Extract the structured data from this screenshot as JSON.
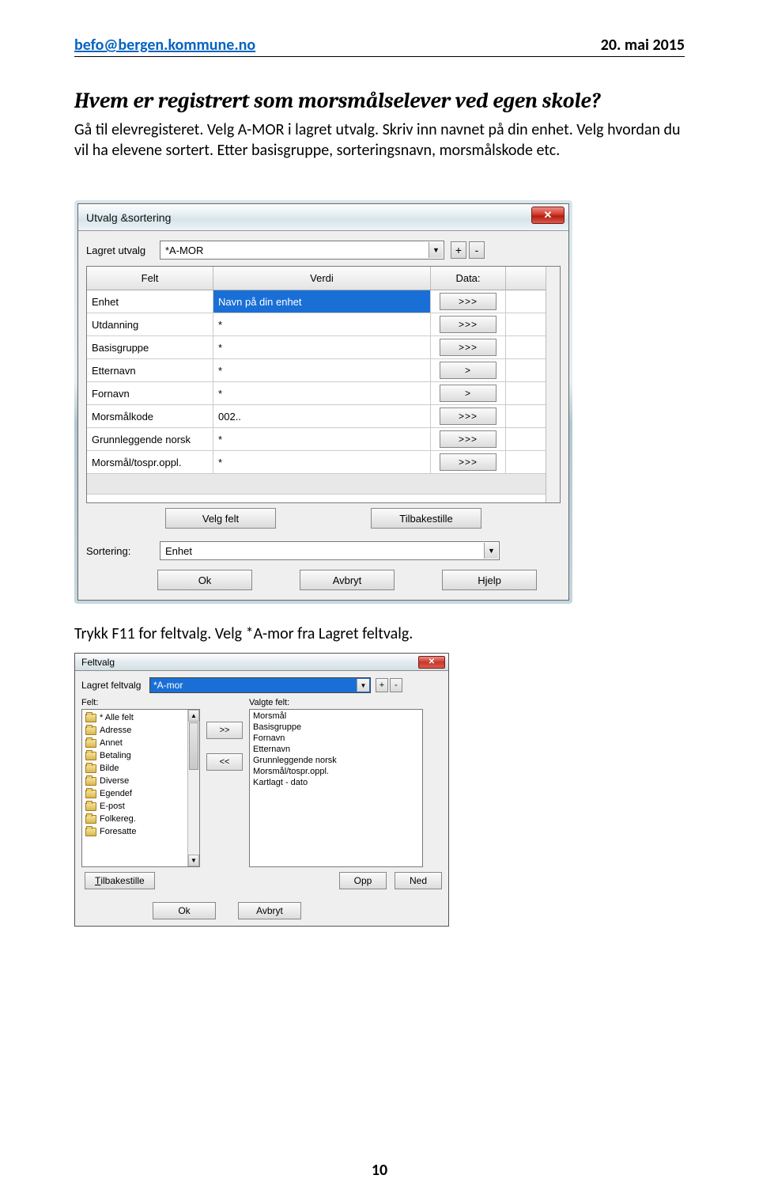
{
  "header": {
    "email": "befo@bergen.kommune.no",
    "date": "20. mai 2015"
  },
  "heading": "Hvem er registrert som morsmålselever ved egen skole?",
  "paragraph": "Gå til elevregisteret. Velg A-MOR i lagret utvalg. Skriv inn navnet på din enhet. Velg hvordan du vil ha elevene sortert. Etter basisgruppe, sorteringsnavn, morsmålskode etc.",
  "dialog1": {
    "title": "Utvalg &sortering",
    "lagret_label": "Lagret utvalg",
    "lagret_value": "*A-MOR",
    "plus": "+",
    "minus": "-",
    "headers": {
      "felt": "Felt",
      "verdi": "Verdi",
      "data": "Data:"
    },
    "rows": [
      {
        "felt": "Enhet",
        "verdi": "Navn på din enhet",
        "data": ">>>",
        "selected": true
      },
      {
        "felt": "Utdanning",
        "verdi": "*",
        "data": ">>>"
      },
      {
        "felt": "Basisgruppe",
        "verdi": "*",
        "data": ">>>"
      },
      {
        "felt": "Etternavn",
        "verdi": "*",
        "data": ">"
      },
      {
        "felt": "Fornavn",
        "verdi": "*",
        "data": ">"
      },
      {
        "felt": "Morsmålkode",
        "verdi": "002..",
        "data": ">>>"
      },
      {
        "felt": "Grunnleggende norsk",
        "verdi": "*",
        "data": ">>>"
      },
      {
        "felt": "Morsmål/tospr.oppl.",
        "verdi": "*",
        "data": ">>>"
      }
    ],
    "velg_felt": "Velg felt",
    "tilbakestille": "Tilbakestille",
    "sortering_label": "Sortering:",
    "sortering_value": "Enhet",
    "ok": "Ok",
    "avbryt": "Avbryt",
    "hjelp": "Hjelp"
  },
  "midtext": "Trykk F11 for feltvalg. Velg *A-mor fra Lagret feltvalg.",
  "dialog2": {
    "title": "Feltvalg",
    "lagret_label": "Lagret feltvalg",
    "lagret_value": "*A-mor",
    "plus": "+",
    "minus": "-",
    "felt_label": "Felt:",
    "felt_items": [
      "* Alle felt",
      "Adresse",
      "Annet",
      "Betaling",
      "Bilde",
      "Diverse",
      "Egendef",
      "E-post",
      "Folkereg.",
      "Foresatte"
    ],
    "valgte_label": "Valgte felt:",
    "valgte_items": [
      "Morsmål",
      "Basisgruppe",
      "Fornavn",
      "Etternavn",
      "Grunnleggende norsk",
      "Morsmål/tospr.oppl.",
      "Kartlagt - dato"
    ],
    "add": ">>",
    "remove": "<<",
    "tilbakestille_u": "T",
    "tilbakestille_rest": "ilbakestille",
    "opp": "Opp",
    "ned": "Ned",
    "ok": "Ok",
    "avbryt": "Avbryt"
  },
  "pagenum": "10"
}
